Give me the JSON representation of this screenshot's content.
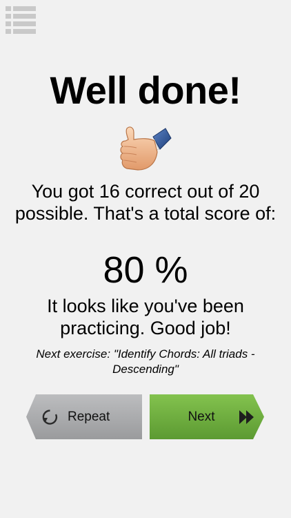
{
  "header": {
    "menu_icon": "list-menu-icon"
  },
  "title": "Well done!",
  "thumbs_icon": "thumbs-up-icon",
  "result": {
    "summary": "You got 16 correct out of 20 possible. That's a total score of:",
    "score": "80 %",
    "feedback": "It looks like you've been practicing. Good job!",
    "next_exercise": "Next exercise: \"Identify Chords: All triads - Descending\""
  },
  "buttons": {
    "repeat_label": "Repeat",
    "repeat_icon": "repeat-icon",
    "next_label": "Next",
    "next_icon": "fast-forward-icon"
  },
  "colors": {
    "background": "#f1f1f1",
    "repeat_button": "#a7a8aa",
    "next_button": "#6fae3f"
  }
}
